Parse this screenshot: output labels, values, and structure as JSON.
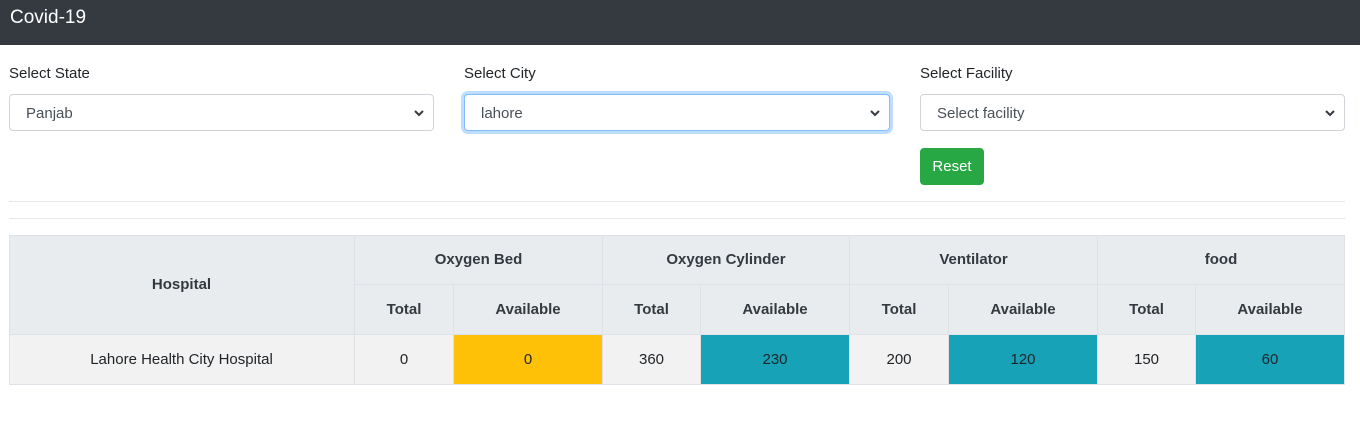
{
  "navbar": {
    "brand": "Covid-19"
  },
  "filters": {
    "state": {
      "label": "Select State",
      "value": "Panjab"
    },
    "city": {
      "label": "Select City",
      "value": "lahore"
    },
    "facility": {
      "label": "Select Facility",
      "value": "Select facility"
    },
    "reset_label": "Reset"
  },
  "table": {
    "hospital_header": "Hospital",
    "groups": [
      "Oxygen Bed",
      "Oxygen Cylinder",
      "Ventilator",
      "food"
    ],
    "sub_headers": [
      "Total",
      "Available",
      "Total",
      "Available",
      "Total",
      "Available",
      "Total",
      "Available"
    ],
    "rows": [
      {
        "hospital": "Lahore Health City Hospital",
        "values": [
          "0",
          "0",
          "360",
          "230",
          "200",
          "120",
          "150",
          "60"
        ]
      }
    ]
  },
  "colors": {
    "navbar": "#343a40",
    "reset_button": "#28a745",
    "available_low": "#ffc107",
    "available_ok": "#17a2b8"
  },
  "icons": {
    "select_arrow": "chevron-down-icon"
  }
}
